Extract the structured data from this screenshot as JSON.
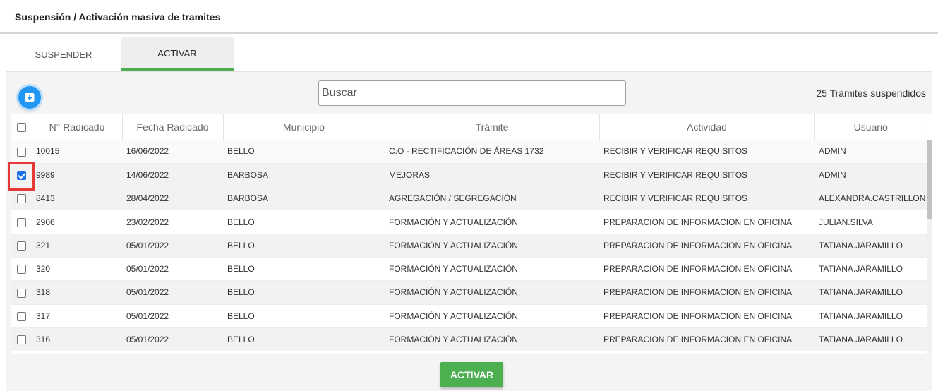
{
  "header": {
    "title": "Suspensión / Activación masiva de tramites"
  },
  "tabs": [
    {
      "label": "SUSPENDER",
      "active": false
    },
    {
      "label": "ACTIVAR",
      "active": true
    }
  ],
  "toolbar": {
    "fab_icon": "download-box-icon",
    "search_placeholder": "Buscar",
    "count_text": "25 Trámites suspendidos"
  },
  "table": {
    "columns": [
      "N° Radicado",
      "Fecha Radicado",
      "Municipio",
      "Trámite",
      "Actividad",
      "Usuario"
    ],
    "rows": [
      {
        "checked": false,
        "cells": [
          "10015",
          "16/06/2022",
          "BELLO",
          "C.O - RECTIFICACIÓN DE ÁREAS 1732",
          "RECIBIR Y VERIFICAR REQUISITOS",
          "ADMIN"
        ]
      },
      {
        "checked": true,
        "cells": [
          "9989",
          "14/06/2022",
          "BARBOSA",
          "MEJORAS",
          "RECIBIR Y VERIFICAR REQUISITOS",
          "ADMIN"
        ]
      },
      {
        "checked": false,
        "cells": [
          "8413",
          "28/04/2022",
          "BARBOSA",
          "AGREGACIÓN / SEGREGACIÓN",
          "RECIBIR Y VERIFICAR REQUISITOS",
          "ALEXANDRA.CASTRILLON"
        ]
      },
      {
        "checked": false,
        "cells": [
          "2906",
          "23/02/2022",
          "BELLO",
          "FORMACIÓN Y ACTUALIZACIÓN",
          "PREPARACION DE INFORMACION EN OFICINA",
          "JULIAN.SILVA"
        ]
      },
      {
        "checked": false,
        "cells": [
          "321",
          "05/01/2022",
          "BELLO",
          "FORMACIÓN Y ACTUALIZACIÓN",
          "PREPARACION DE INFORMACION EN OFICINA",
          "TATIANA.JARAMILLO"
        ]
      },
      {
        "checked": false,
        "cells": [
          "320",
          "05/01/2022",
          "BELLO",
          "FORMACIÓN Y ACTUALIZACIÓN",
          "PREPARACION DE INFORMACION EN OFICINA",
          "TATIANA.JARAMILLO"
        ]
      },
      {
        "checked": false,
        "cells": [
          "318",
          "05/01/2022",
          "BELLO",
          "FORMACIÓN Y ACTUALIZACIÓN",
          "PREPARACION DE INFORMACION EN OFICINA",
          "TATIANA.JARAMILLO"
        ]
      },
      {
        "checked": false,
        "cells": [
          "317",
          "05/01/2022",
          "BELLO",
          "FORMACIÓN Y ACTUALIZACIÓN",
          "PREPARACION DE INFORMACION EN OFICINA",
          "TATIANA.JARAMILLO"
        ]
      },
      {
        "checked": false,
        "cells": [
          "316",
          "05/01/2022",
          "BELLO",
          "FORMACIÓN Y ACTUALIZACIÓN",
          "PREPARACION DE INFORMACION EN OFICINA",
          "TATIANA.JARAMILLO"
        ]
      }
    ]
  },
  "footer": {
    "activate_label": "ACTIVAR"
  },
  "colors": {
    "accent": "#4caf50",
    "fab": "#2196f3",
    "highlight": "#e53935",
    "checkbox": "#1a73e8"
  }
}
